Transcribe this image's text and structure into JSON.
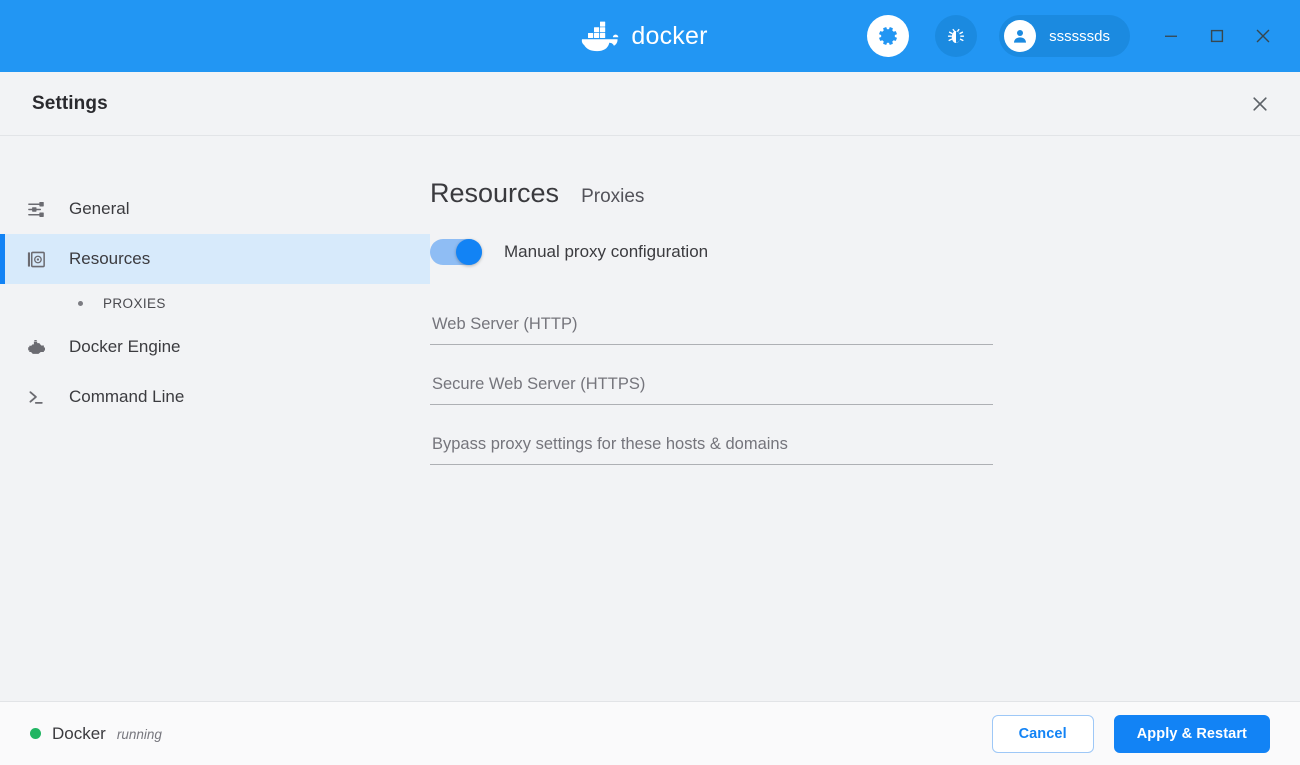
{
  "titlebar": {
    "brand_word": "docker",
    "gear_icon": "gear-icon",
    "bug_icon": "bug-icon",
    "avatar_icon": "user-avatar-icon",
    "account_name": "ssssssds",
    "window_minimize": "minimize-icon",
    "window_maximize": "maximize-icon",
    "window_close": "close-icon",
    "accent_color": "#2296f3"
  },
  "settings_header": {
    "title": "Settings",
    "close_icon": "close-icon"
  },
  "sidebar": {
    "items": [
      {
        "label": "General",
        "icon": "sliders-icon",
        "active": false
      },
      {
        "label": "Resources",
        "icon": "disk-icon",
        "active": true
      },
      {
        "label": "Docker Engine",
        "icon": "engine-icon",
        "active": false
      },
      {
        "label": "Command Line",
        "icon": "terminal-icon",
        "active": false
      }
    ],
    "sub_item": {
      "label": "PROXIES",
      "parent": "Resources"
    },
    "active_bg": "#d7eafb",
    "active_bar": "#1283f5"
  },
  "content": {
    "heading": "Resources",
    "subheading": "Proxies",
    "toggle": {
      "label": "Manual proxy configuration",
      "enabled": true,
      "on_color": "#1283f5",
      "track_color": "#8fbdf4"
    },
    "fields": [
      {
        "name": "web-server-http",
        "placeholder": "Web Server (HTTP)",
        "value": ""
      },
      {
        "name": "secure-web-https",
        "placeholder": "Secure Web Server (HTTPS)",
        "value": ""
      },
      {
        "name": "bypass-proxy",
        "placeholder": "Bypass proxy settings for these hosts & domains",
        "value": ""
      }
    ]
  },
  "footer": {
    "status_name": "Docker",
    "status_state": "running",
    "status_color": "#21b563",
    "cancel_label": "Cancel",
    "apply_label": "Apply & Restart"
  }
}
